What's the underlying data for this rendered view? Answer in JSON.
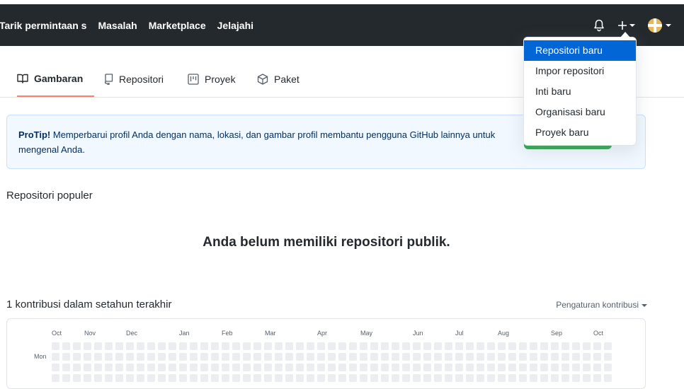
{
  "header": {
    "nav": [
      "Tarik permintaan s",
      "Masalah",
      "Marketplace",
      "Jelajahi"
    ],
    "icons": [
      "bell-icon",
      "plus-icon",
      "avatar"
    ]
  },
  "tabs": [
    {
      "label": "Gambaran",
      "icon": "book-icon",
      "selected": true
    },
    {
      "label": "Repositori",
      "icon": "repo-icon",
      "selected": false
    },
    {
      "label": "Proyek",
      "icon": "project-icon",
      "selected": false
    },
    {
      "label": "Paket",
      "icon": "package-icon",
      "selected": false
    }
  ],
  "protip": {
    "label": "ProTip!",
    "text": " Memperbarui profil Anda dengan nama, lokasi, dan gambar profil membantu pengguna GitHub lainnya untuk mengenal Anda."
  },
  "popular": {
    "title": "Repositori populer",
    "empty": "Anda belum memiliki repositori publik."
  },
  "contrib": {
    "title": "1 kontribusi dalam setahun terakhir",
    "settings": "Pengaturan kontribusi",
    "months": [
      "Oct",
      "Nov",
      "Dec",
      "Jan",
      "Feb",
      "Mar",
      "Apr",
      "May",
      "Jun",
      "Jul",
      "Aug",
      "Sep",
      "Oct"
    ],
    "days": [
      "Mon"
    ]
  },
  "dropdown": {
    "items": [
      "Repositori baru",
      "Impor repositori",
      "Inti baru",
      "Organisasi baru",
      "Proyek baru"
    ],
    "active_index": 0
  },
  "colors": {
    "header_bg": "#24292e",
    "accent": "#f9826c",
    "link_blue": "#0366d6",
    "cell_empty": "#ebedf0"
  }
}
